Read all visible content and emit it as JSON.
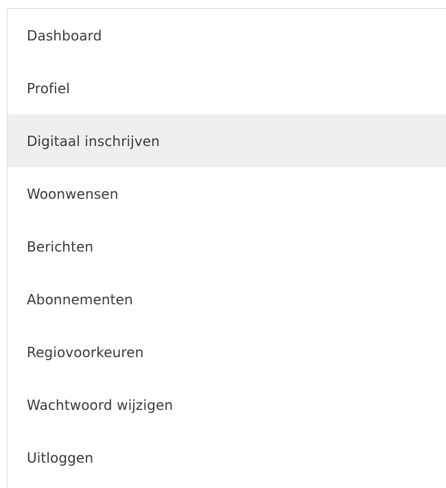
{
  "menu": {
    "active_color": "#efefef",
    "items": [
      {
        "label": "Dashboard"
      },
      {
        "label": "Profiel"
      },
      {
        "label": "Digitaal inschrijven",
        "active": true
      },
      {
        "label": "Woonwensen"
      },
      {
        "label": "Berichten"
      },
      {
        "label": "Abonnementen"
      },
      {
        "label": "Regiovoorkeuren"
      },
      {
        "label": "Wachtwoord wijzigen"
      },
      {
        "label": "Uitloggen"
      }
    ]
  }
}
